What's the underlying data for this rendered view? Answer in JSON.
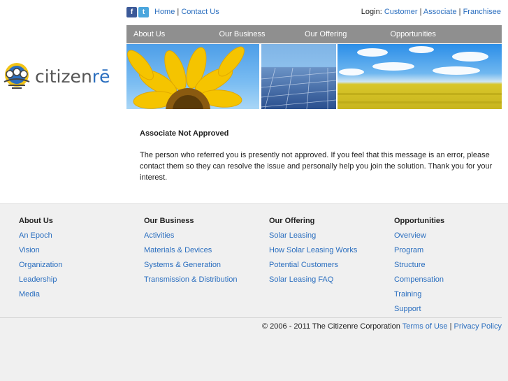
{
  "top": {
    "links": [
      "Home",
      "Contact Us"
    ],
    "login_label": "Login:",
    "login_links": [
      "Customer",
      "Associate",
      "Franchisee"
    ]
  },
  "logo": {
    "text_main": "citizen",
    "text_accent": "rē"
  },
  "nav": [
    "About Us",
    "Our Business",
    "Our Offering",
    "Opportunities"
  ],
  "content": {
    "title": "Associate Not Approved",
    "body": "The person who referred you is presently not approved. If you feel that this message is an error, please contact them so they can resolve the issue and personally help you join the solution. Thank you for your interest."
  },
  "footer": {
    "columns": [
      {
        "heading": "About Us",
        "links": [
          "An Epoch",
          "Vision",
          "Organization",
          "Leadership",
          "Media"
        ]
      },
      {
        "heading": "Our Business",
        "links": [
          "Activities",
          "Materials & Devices",
          "Systems & Generation",
          "Transmission & Distribution"
        ]
      },
      {
        "heading": "Our Offering",
        "links": [
          "Solar Leasing",
          "How Solar Leasing Works",
          "Potential Customers",
          "Solar Leasing FAQ"
        ]
      },
      {
        "heading": "Opportunities",
        "links": [
          "Overview",
          "Program",
          "Structure",
          "Compensation",
          "Training",
          "Support"
        ]
      }
    ],
    "copyright": "© 2006 - 2011 The Citizenre Corporation",
    "legal_links": [
      "Terms of Use",
      "Privacy Policy"
    ]
  },
  "colors": {
    "link": "#2a6ebf",
    "nav_bg": "#8f8f8f",
    "footer_bg": "#f0f0f0"
  }
}
